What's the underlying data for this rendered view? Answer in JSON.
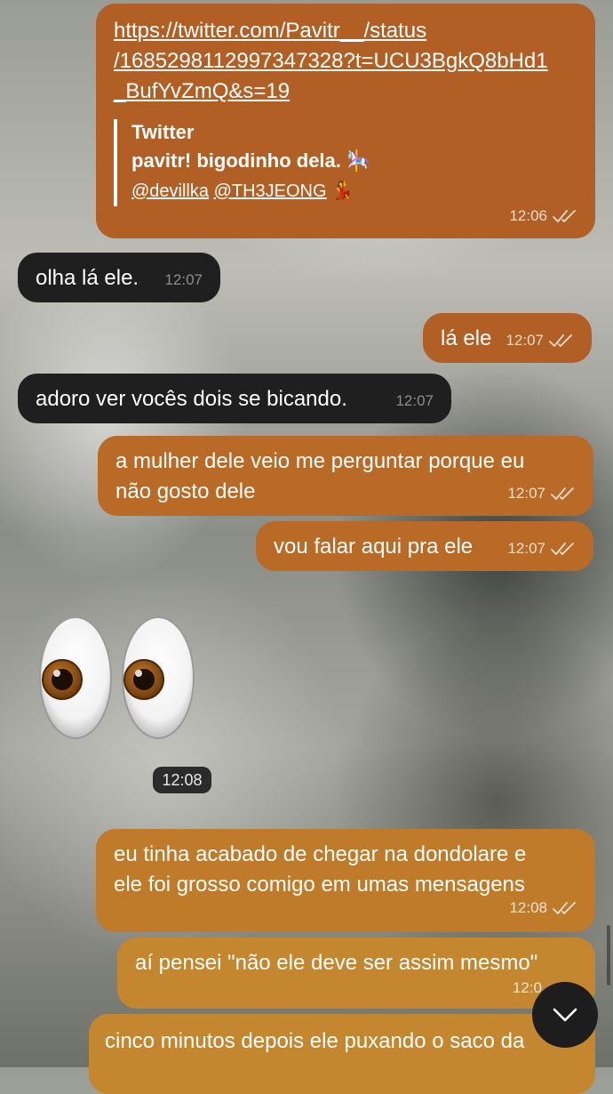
{
  "messages": [
    {
      "link_lines": [
        "https://twitter.com/Pavitr__/status",
        "/1685298112997347328?t=UCU3BgkQ8bHd1",
        "_BufYvZmQ&s=19"
      ],
      "preview": {
        "site": "Twitter",
        "text": "pavitr! bigodinho dela. 🎠",
        "mention1": "@devillka",
        "mention2": "@TH3JEONG",
        "mention_emoji": "💃"
      },
      "time": "12:06"
    },
    {
      "text": "olha lá ele.",
      "time": "12:07"
    },
    {
      "text": "lá ele",
      "time": "12:07"
    },
    {
      "text": "adoro ver vocês dois se bicando.",
      "time": "12:07"
    },
    {
      "lines": [
        "a mulher dele veio me perguntar porque eu",
        "não gosto dele"
      ],
      "time": "12:07"
    },
    {
      "text": "vou falar aqui pra ele",
      "time": "12:07"
    },
    {
      "time": "12:08"
    },
    {
      "lines": [
        "eu tinha acabado de chegar na dondolare e",
        "ele foi grosso comigo em umas mensagens"
      ],
      "time": "12:08"
    },
    {
      "text": "aí pensei \"não ele deve ser assim mesmo\"",
      "time": "12:0"
    },
    {
      "text": "cinco minutos depois ele puxando o saco da"
    }
  ],
  "icons": {
    "read_receipt": "double-check-icon",
    "scroll_down": "chevron-down-icon",
    "sticker": "eyes-emoji"
  },
  "colors": {
    "outgoing": "#b25f25",
    "incoming": "#1f1f1f"
  }
}
